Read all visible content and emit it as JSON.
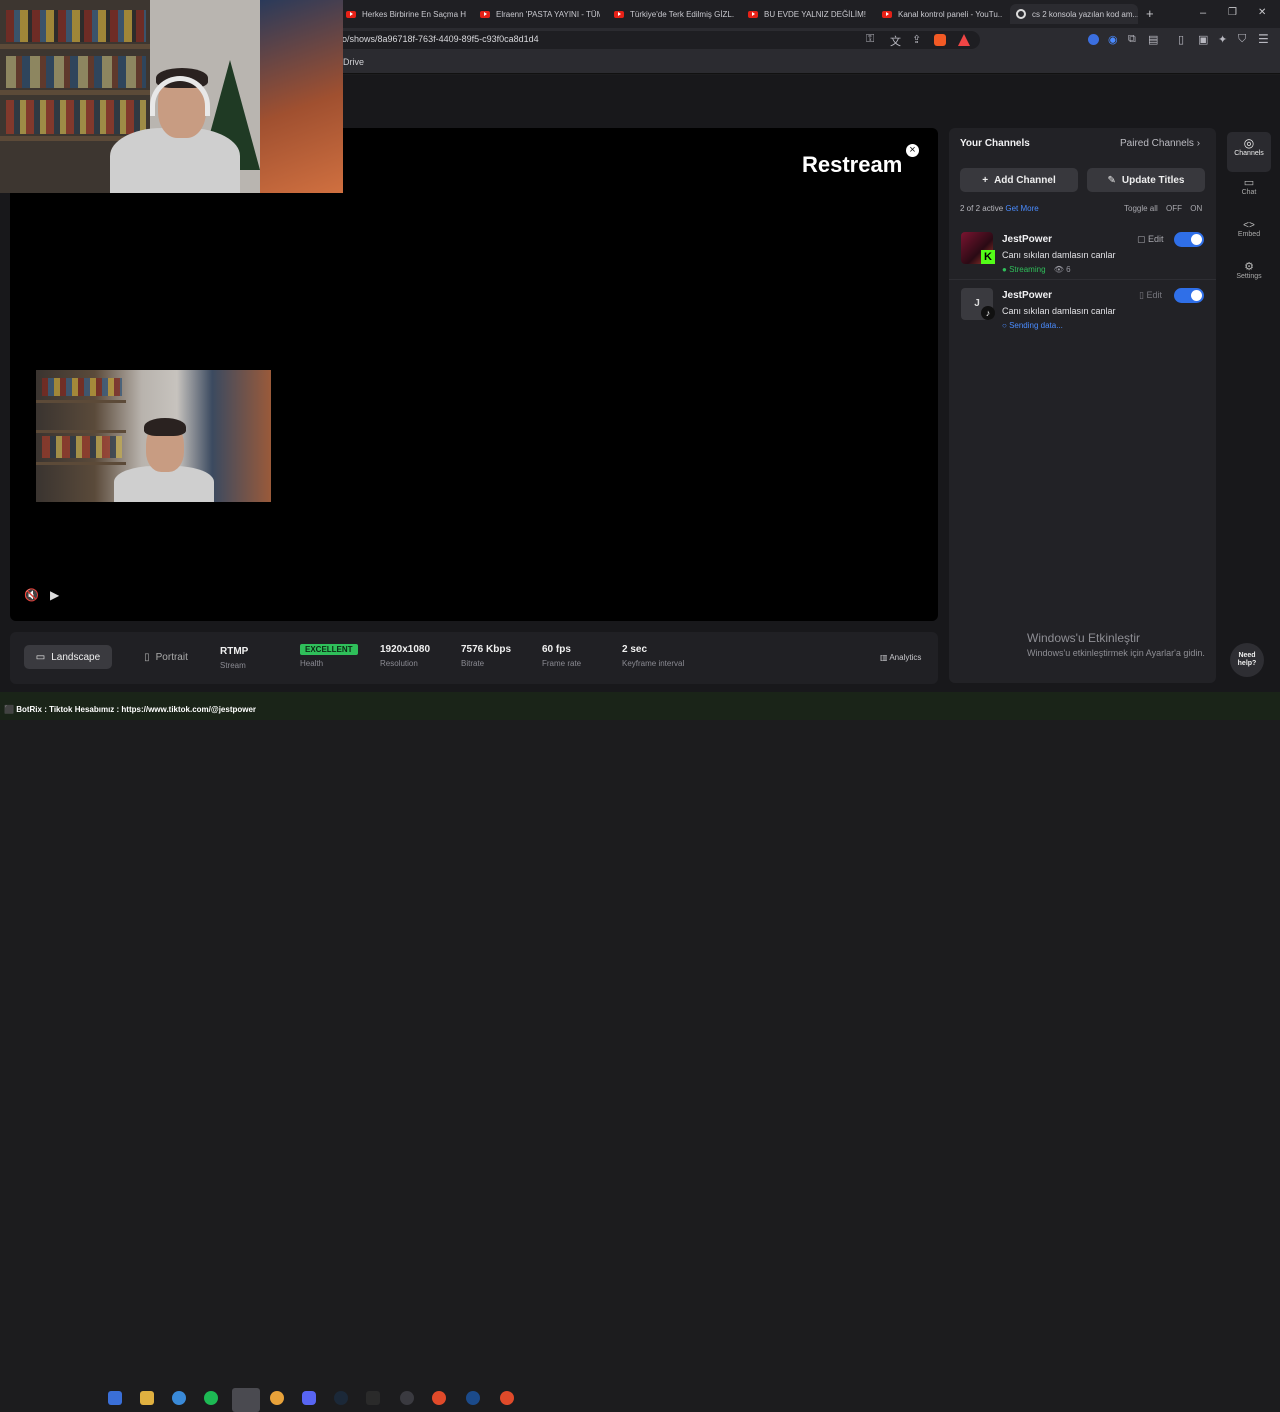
{
  "browser": {
    "tabs": [
      {
        "label": "Herkes Birbirine En Saçma H...",
        "icon": "youtube-icon"
      },
      {
        "label": "Elraenn 'PASTA YAYINI - TÜM...",
        "icon": "youtube-icon"
      },
      {
        "label": "Türkiye'de Terk Edilmiş GİZL...",
        "icon": "youtube-icon"
      },
      {
        "label": "BU EVDE YALNIZ DEĞİLİM! |...",
        "icon": "youtube-icon"
      },
      {
        "label": "Kanal kontrol paneli - YouTu...",
        "icon": "youtube-icon"
      },
      {
        "label": "cs 2 konsola yazılan kod am...",
        "icon": "google-icon"
      }
    ],
    "new_tab": "+",
    "url": "o/shows/8a96718f-763f-4409-89f5-c93f0ca8d1d4",
    "bookmark": "Drive",
    "window_controls": {
      "minimize": "–",
      "restore": "❐",
      "close": "✕"
    }
  },
  "player": {
    "brand": "Restream",
    "close": "×",
    "mute": "🔇",
    "play": "▶"
  },
  "stats": {
    "landscape": "Landscape",
    "portrait": "Portrait",
    "items": [
      {
        "value": "RTMP",
        "label": "Stream"
      },
      {
        "value": "EXCELLENT",
        "label": "Health"
      },
      {
        "value": "1920x1080",
        "label": "Resolution"
      },
      {
        "value": "7576 Kbps",
        "label": "Bitrate"
      },
      {
        "value": "60 fps",
        "label": "Frame rate"
      },
      {
        "value": "2 sec",
        "label": "Keyframe interval"
      }
    ],
    "analytics": "Analytics"
  },
  "panel": {
    "title": "Your Channels",
    "paired": "Paired Channels",
    "add_channel": "Add Channel",
    "update_titles": "Update Titles",
    "active": "2 of 2 active",
    "get_more": "Get More",
    "toggle_all": "Toggle all",
    "off": "OFF",
    "on": "ON",
    "channels": [
      {
        "name": "JestPower",
        "title": "Canı sıkılan damlasın canlar",
        "status": "Streaming",
        "viewers": "6",
        "edit": "Edit",
        "platform": "kick",
        "enabled": true
      },
      {
        "name": "JestPower",
        "title": "Canı sıkılan damlasın canlar",
        "status": "Sending data...",
        "edit": "Edit",
        "platform": "tiktok",
        "avatar": "J",
        "enabled": true
      }
    ]
  },
  "rail": {
    "channels": "Channels",
    "chat": "Chat",
    "embed": "Embed",
    "settings": "Settings"
  },
  "activation": {
    "title": "Windows'u Etkinleştir",
    "subtitle": "Windows'u etkinleştirmek için Ayarlar'a gidin."
  },
  "help": {
    "line1": "Need",
    "line2": "help?"
  },
  "taskbar": {
    "ticker": "BotRix : Tiktok Hesabımız : https://www.tiktok.com/@jestpower"
  }
}
